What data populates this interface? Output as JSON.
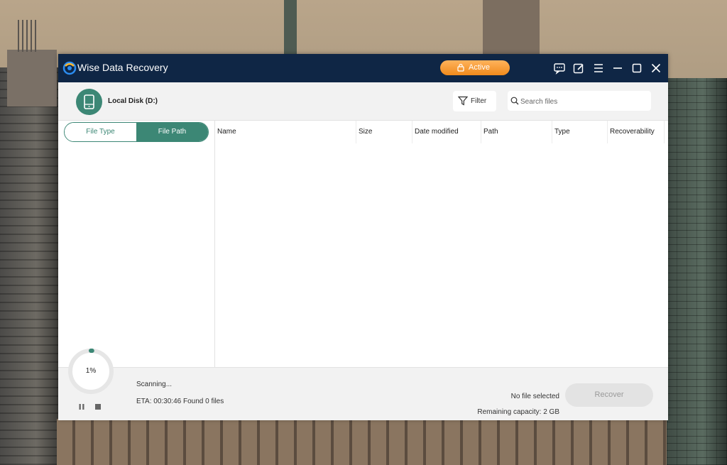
{
  "window": {
    "title": "Wise Data Recovery",
    "active_label": "Active",
    "icons": [
      "feedback-icon",
      "edit-icon",
      "menu-icon",
      "minimize-icon",
      "maximize-icon",
      "close-icon"
    ]
  },
  "toolbar": {
    "disk_name": "Local Disk (D:)",
    "filter_label": "Filter",
    "search_placeholder": "Search files"
  },
  "left_panel": {
    "tabs": [
      {
        "label": "File Type",
        "selected": false
      },
      {
        "label": "File Path",
        "selected": true
      }
    ]
  },
  "table": {
    "columns": [
      "Name",
      "Size",
      "Date modified",
      "Path",
      "Type",
      "Recoverability"
    ],
    "rows": []
  },
  "footer": {
    "progress_text": "1%",
    "progress_value": 0.01,
    "status": "Scanning...",
    "eta": "ETA: 00:30:46 Found 0 files",
    "selection": "No file selected",
    "remaining": "Remaining capacity: 2 GB",
    "recover_label": "Recover"
  },
  "colors": {
    "titlebar": "#0f2645",
    "accent": "#3c8775",
    "active_button": "#f59a2e"
  }
}
